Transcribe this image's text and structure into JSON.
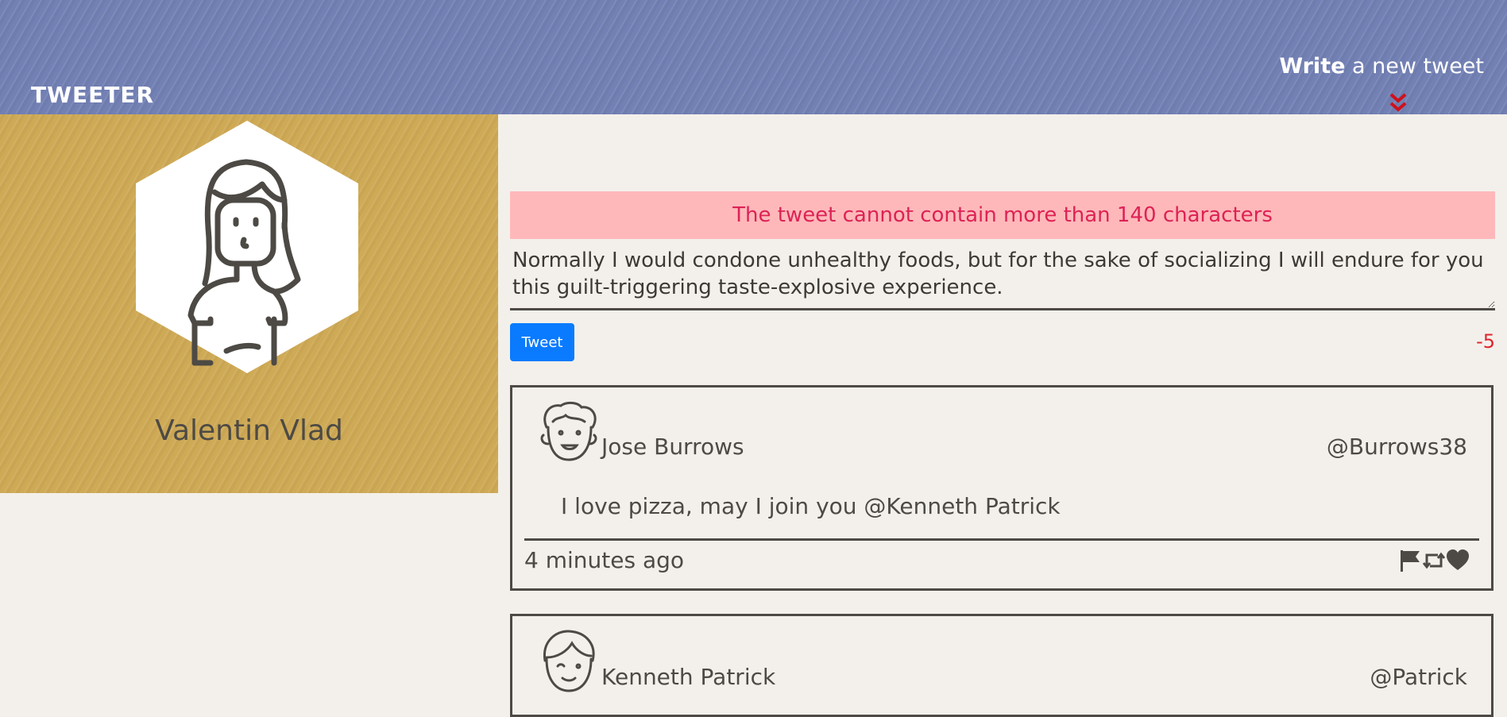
{
  "nav": {
    "brand": "TWEETER",
    "write_bold": "Write",
    "write_rest": " a new tweet"
  },
  "profile": {
    "name": "Valentin Vlad"
  },
  "composer": {
    "error": "The tweet cannot contain more than 140 characters",
    "text": "Normally I would condone unhealthy foods, but for the sake of socializing I will endure for you this guilt-triggering taste-explosive experience.",
    "button_label": "Tweet",
    "counter": "-5"
  },
  "tweets": [
    {
      "name": "Jose Burrows",
      "handle": "@Burrows38",
      "text": "I love pizza, may I join you @Kenneth Patrick",
      "time": "4 minutes ago",
      "actions": [
        "flag-icon",
        "retweet-icon",
        "heart-icon"
      ]
    },
    {
      "name": "Kenneth Patrick",
      "handle": "@Patrick"
    }
  ],
  "colors": {
    "nav": "#7280b4",
    "profile": "#cfaa56",
    "background": "#f3f0eb",
    "error_bg": "#ffb8ba",
    "error_text": "#dd2255",
    "button": "#0a7bff",
    "chevron": "#d0101a"
  }
}
